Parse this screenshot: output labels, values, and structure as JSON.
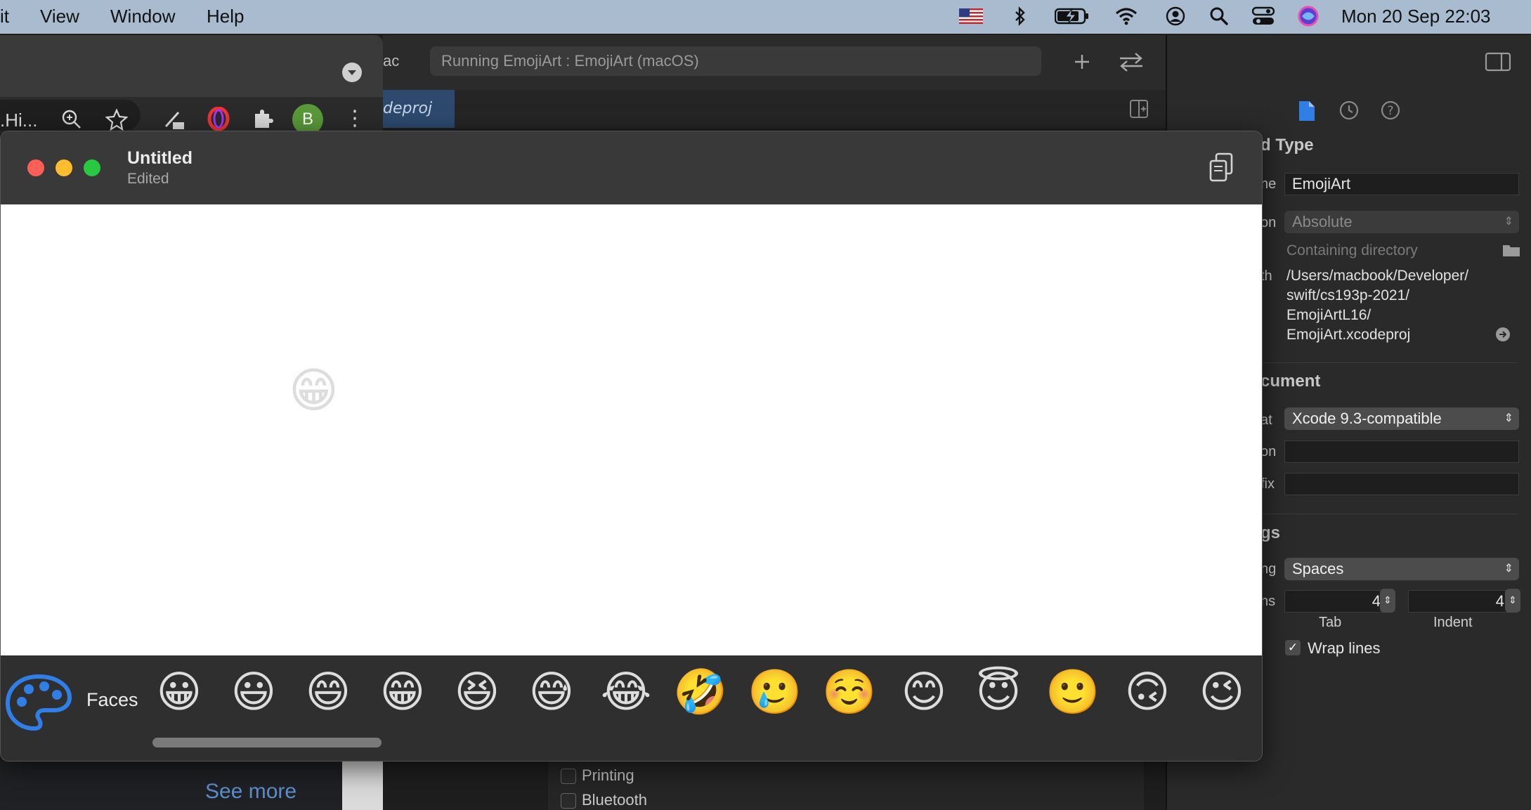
{
  "menubar": {
    "items": [
      "it",
      "View",
      "Window",
      "Help"
    ],
    "clock": "Mon 20 Sep  22:03"
  },
  "chrome": {
    "tab_label": ".Hi...",
    "avatar_letter": "B",
    "footer_link": "See more"
  },
  "xcode": {
    "tab_fragment": "ac",
    "run_status": "Running EmojiArt : EmojiArt (macOS)",
    "project_tab": "deproj",
    "options": [
      {
        "label": "Printing",
        "checked": false
      },
      {
        "label": "Bluetooth",
        "checked": false
      }
    ]
  },
  "inspector": {
    "section_name_type": "d Type",
    "name_label": "ne",
    "name_value": "EmojiArt",
    "location_label": "on",
    "location_value": "Absolute",
    "containing_directory": "Containing directory",
    "full_path_label": "th",
    "full_path_lines": [
      "/Users/macbook/Developer/",
      "swift/cs193p-2021/",
      "EmojiArtL16/",
      "EmojiArt.xcodeproj"
    ],
    "section_document": "cument",
    "format_label": "at",
    "format_value": "Xcode 9.3-compatible",
    "org_label": "on",
    "prefix_label": "fix",
    "section_settings": "gs",
    "indent_using_label": "ng",
    "indent_using_value": "Spaces",
    "widths_label": "ns",
    "tab_width": "4",
    "indent_width": "4",
    "tab_caption": "Tab",
    "indent_caption": "Indent",
    "wrap_lines": "Wrap lines",
    "wrap_lines_checked": true
  },
  "document": {
    "title": "Untitled",
    "subtitle": "Edited",
    "canvas_emoji": "😁",
    "palette_name": "Faces",
    "palette_emojis": [
      "😀",
      "😃",
      "😄",
      "😁",
      "😆",
      "😅",
      "😂",
      "🤣",
      "🥲",
      "☺️",
      "😊",
      "😇",
      "🙂",
      "🙃",
      "😉"
    ]
  },
  "colors": {
    "menubar": "#a9bccf",
    "close": "#ff5f57",
    "minimize": "#febc2e",
    "zoom": "#28c840",
    "accent": "#2f7fe6"
  }
}
